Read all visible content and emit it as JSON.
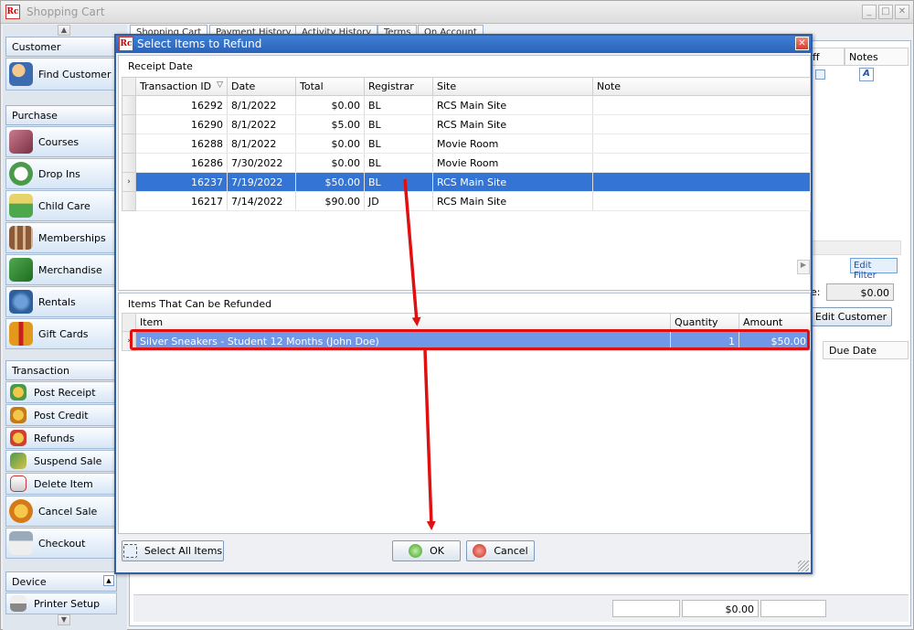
{
  "main": {
    "title": "Shopping Cart",
    "win_min": "_",
    "win_max": "□",
    "win_close": "✕",
    "tabs": [
      "Shopping Cart",
      "Payment History",
      "Activity History",
      "Terms",
      "On Account"
    ]
  },
  "sidebar": {
    "customer_header": "Customer",
    "find_customer": "Find Customer",
    "purchase_header": "Purchase",
    "purchase_items": [
      "Courses",
      "Drop Ins",
      "Child Care",
      "Memberships",
      "Merchandise",
      "Rentals",
      "Gift Cards"
    ],
    "transaction_header": "Transaction",
    "transaction_items": [
      "Post Receipt",
      "Post Credit",
      "Refunds",
      "Suspend Sale",
      "Delete Item",
      "Cancel Sale",
      "Checkout"
    ],
    "device_header": "Device",
    "device_items": [
      "Printer Setup"
    ]
  },
  "background": {
    "col_off": "ff",
    "col_notes": "Notes",
    "edit_filter": "Edit Filter",
    "balance_label": "e:",
    "balance_value": "$0.00",
    "edit_customer": "Edit Customer",
    "due_date": "Due Date",
    "footer_total": "$0.00"
  },
  "dialog": {
    "title": "Select Items to Refund",
    "receipt_group": "Receipt Date",
    "receipt_columns": [
      "Transaction ID",
      "Date",
      "Total",
      "Registrar",
      "Site",
      "Note"
    ],
    "receipts": [
      {
        "id": "16292",
        "date": "8/1/2022",
        "total": "$0.00",
        "registrar": "BL",
        "site": "RCS Main Site",
        "note": ""
      },
      {
        "id": "16290",
        "date": "8/1/2022",
        "total": "$5.00",
        "registrar": "BL",
        "site": "RCS Main Site",
        "note": ""
      },
      {
        "id": "16288",
        "date": "8/1/2022",
        "total": "$0.00",
        "registrar": "BL",
        "site": "Movie Room",
        "note": ""
      },
      {
        "id": "16286",
        "date": "7/30/2022",
        "total": "$0.00",
        "registrar": "BL",
        "site": "Movie Room",
        "note": ""
      },
      {
        "id": "16237",
        "date": "7/19/2022",
        "total": "$50.00",
        "registrar": "BL",
        "site": "RCS Main Site",
        "note": ""
      },
      {
        "id": "16217",
        "date": "7/14/2022",
        "total": "$90.00",
        "registrar": "JD",
        "site": "RCS Main Site",
        "note": ""
      }
    ],
    "selected_receipt_index": 4,
    "sort_indicator": "▽",
    "items_group": "Items That Can be Refunded",
    "item_columns": [
      "Item",
      "Quantity",
      "Amount"
    ],
    "items": [
      {
        "item": "Silver Sneakers - Student 12 Months (John Doe)",
        "quantity": "1",
        "amount": "$50.00"
      }
    ],
    "select_all_label": "Select All Items",
    "ok_label": "OK",
    "cancel_label": "Cancel"
  },
  "colors": {
    "accent": "#3474d4",
    "annotation": "#e01010"
  }
}
